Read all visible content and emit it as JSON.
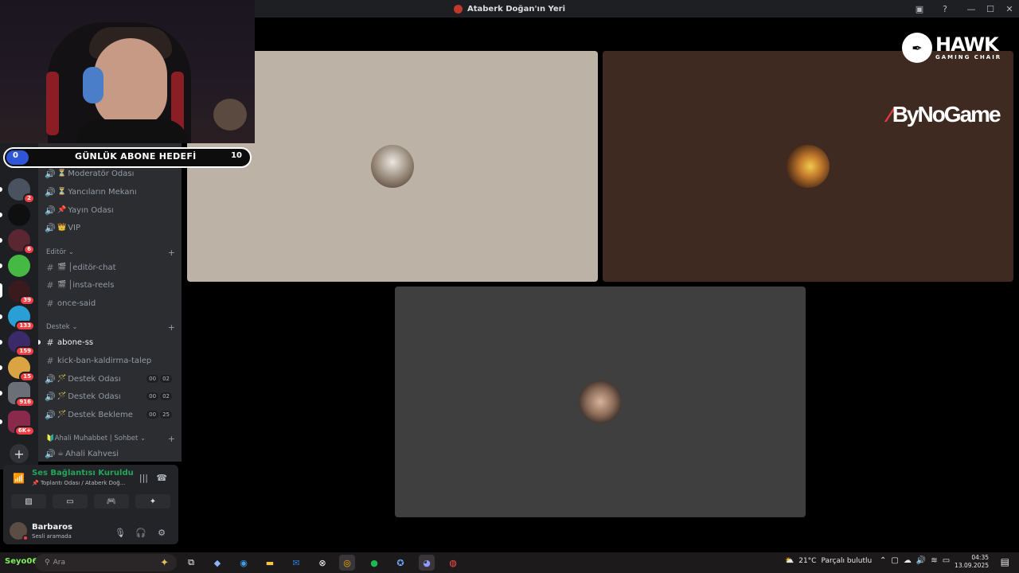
{
  "window": {
    "title": "Ataberk Doğan'ın Yeri"
  },
  "goal_bar": {
    "start": "0",
    "label": "GÜNLÜK ABONE HEDEFİ",
    "end": "10"
  },
  "guild_rail": {
    "badges": [
      "2",
      "6",
      "39",
      "133",
      "159",
      "15",
      "916",
      "6K+"
    ]
  },
  "sidebar": {
    "channels_top": [
      {
        "icon": "voice",
        "emoji": "⏳",
        "name": "Moderatör Odası"
      },
      {
        "icon": "voice",
        "emoji": "⏳",
        "name": "Yancıların Mekanı"
      },
      {
        "icon": "voice",
        "emoji": "📌",
        "name": "Yayın Odası"
      },
      {
        "icon": "voice",
        "emoji": "👑",
        "name": "VIP"
      }
    ],
    "cat_editor": "Editör",
    "editor_channels": [
      {
        "icon": "text",
        "emoji": "🎬",
        "name": "│editör-chat"
      },
      {
        "icon": "text",
        "emoji": "🎬",
        "name": "│insta-reels"
      },
      {
        "icon": "text",
        "emoji": "",
        "name": "once-said"
      }
    ],
    "cat_destek": "Destek",
    "destek_channels": [
      {
        "icon": "text",
        "emoji": "",
        "name": "abone-ss",
        "active": true
      },
      {
        "icon": "text",
        "emoji": "",
        "name": "kick-ban-kaldirma-talep"
      },
      {
        "icon": "voice",
        "emoji": "🪄",
        "name": "Destek Odası",
        "c1": "00",
        "c2": "02"
      },
      {
        "icon": "voice",
        "emoji": "🪄",
        "name": "Destek Odası",
        "c1": "00",
        "c2": "02"
      },
      {
        "icon": "voice",
        "emoji": "🪄",
        "name": "Destek Bekleme",
        "c1": "00",
        "c2": "25"
      }
    ],
    "cat_ahali": "🔰Ahali Muhabbet | Sohbet",
    "ahali_channels": [
      {
        "icon": "voice",
        "emoji": "☕",
        "name": "Ahali Kahvesi"
      }
    ]
  },
  "voice_panel": {
    "status": "Ses Bağlantısı Kuruldu",
    "sub": "📌 Toplantı Odası / Ataberk Doğ..."
  },
  "user_panel": {
    "name": "Barbaros",
    "status": "Sesli aramada"
  },
  "sponsors": {
    "hawk_name": "HAWK",
    "hawk_sub": "GAMING CHAIR",
    "bynogame": "ByNoGame"
  },
  "taskbar": {
    "user": "Seyo06",
    "search_placeholder": "Ara",
    "weather_temp": "21°C",
    "weather_desc": "Parçalı bulutlu",
    "time": "04:35",
    "date": "13.09.2025"
  },
  "colors": {
    "accent_green": "#23a55a",
    "badge_red": "#f23f43",
    "goal_blue": "#2f56d6"
  }
}
